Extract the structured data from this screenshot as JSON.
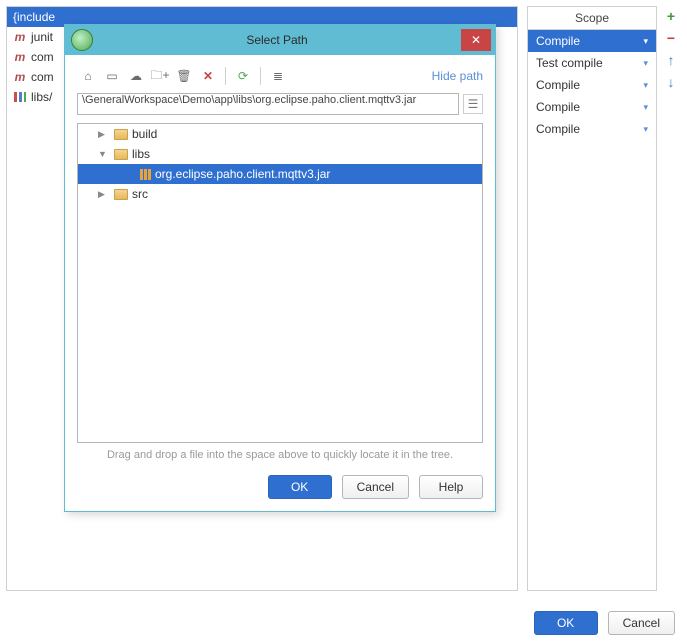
{
  "background": {
    "rows": [
      {
        "icon": "include",
        "label": "{include"
      },
      {
        "icon": "m",
        "label": "junit"
      },
      {
        "icon": "m",
        "label": "com"
      },
      {
        "icon": "m",
        "label": "com"
      },
      {
        "icon": "bars",
        "label": "libs/"
      }
    ],
    "buttons": {
      "ok": "OK",
      "cancel": "Cancel"
    }
  },
  "scope": {
    "header": "Scope",
    "items": [
      {
        "label": "Compile",
        "selected": true
      },
      {
        "label": "Test compile",
        "selected": false
      },
      {
        "label": "Compile",
        "selected": false
      },
      {
        "label": "Compile",
        "selected": false
      },
      {
        "label": "Compile",
        "selected": false
      }
    ]
  },
  "actions": {
    "add": "+",
    "remove": "−",
    "up": "↑",
    "down": "↓"
  },
  "dialog": {
    "title": "Select Path",
    "hide_path": "Hide path",
    "path": "\\GeneralWorkspace\\Demo\\app\\libs\\org.eclipse.paho.client.mqttv3.jar",
    "tree": [
      {
        "depth": 1,
        "expand": "▶",
        "icon": "folder",
        "label": "build",
        "selected": false
      },
      {
        "depth": 1,
        "expand": "▼",
        "icon": "folder",
        "label": "libs",
        "selected": false
      },
      {
        "depth": 2,
        "expand": "",
        "icon": "jar",
        "label": "org.eclipse.paho.client.mqttv3.jar",
        "selected": true
      },
      {
        "depth": 1,
        "expand": "▶",
        "icon": "folder",
        "label": "src",
        "selected": false
      }
    ],
    "hint": "Drag and drop a file into the space above to quickly locate it in the tree.",
    "buttons": {
      "ok": "OK",
      "cancel": "Cancel",
      "help": "Help"
    },
    "toolbar": {
      "home": "⌂",
      "module": "▭",
      "chat": "☁",
      "newfolder": "🗀+",
      "delete": "🗑",
      "x": "✕",
      "refresh": "⟳",
      "list": "≣"
    }
  }
}
